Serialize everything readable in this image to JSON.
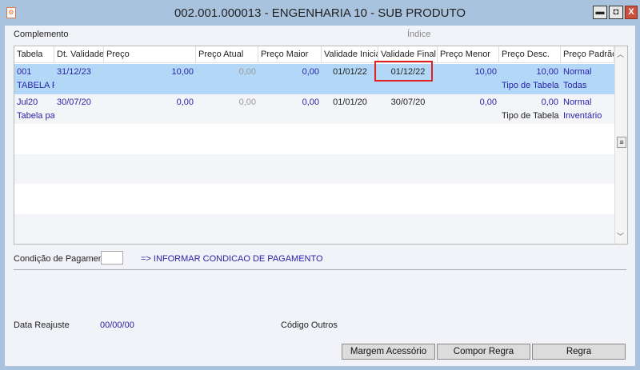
{
  "window": {
    "title": "002.001.000013 - ENGENHARIA 10 - SUB PRODUTO",
    "icon": "app-logo-icon",
    "controls": {
      "minimize": "▬",
      "maximize": "◘",
      "close": "X"
    }
  },
  "labels": {
    "complemento": "Complemento",
    "indice": "Índice"
  },
  "grid": {
    "columns": [
      "Tabela",
      "Dt. Validade",
      "Preço",
      "Preço Atual",
      "Preço Maior",
      "Validade Inicial",
      "Validade Final",
      "Preço Menor",
      "Preço Desc.",
      "Preço Padrão"
    ],
    "rows": [
      {
        "selected": true,
        "cells": [
          "001",
          "31/12/23",
          "10,00",
          "0,00",
          "0,00",
          "01/01/22",
          "01/12/22",
          "10,00",
          "10,00",
          "Normal"
        ],
        "line2": {
          "tabela": "TABELA PAI",
          "tipo_label": "Tipo de Tabela",
          "tipo_value": "Todas"
        }
      },
      {
        "selected": false,
        "cells": [
          "Jul20",
          "30/07/20",
          "0,00",
          "0,00",
          "0,00",
          "01/01/20",
          "30/07/20",
          "0,00",
          "0,00",
          "Normal"
        ],
        "line2": {
          "tabela": "Tabela para",
          "tipo_label": "Tipo de Tabela",
          "tipo_value": "Inventário"
        }
      }
    ],
    "selected_color": "#b3d8f7",
    "highlight_color": "#e02020"
  },
  "pagamento": {
    "label": "Condição de Pagamento",
    "value": "",
    "hint": "=> INFORMAR CONDICAO DE PAGAMENTO"
  },
  "reajuste": {
    "label": "Data Reajuste",
    "value": "00/00/00"
  },
  "codigo_outros": {
    "label": "Código Outros"
  },
  "buttons": {
    "margem": "Margem Acessório",
    "compor": "Compor Regra",
    "regra": "Regra"
  }
}
